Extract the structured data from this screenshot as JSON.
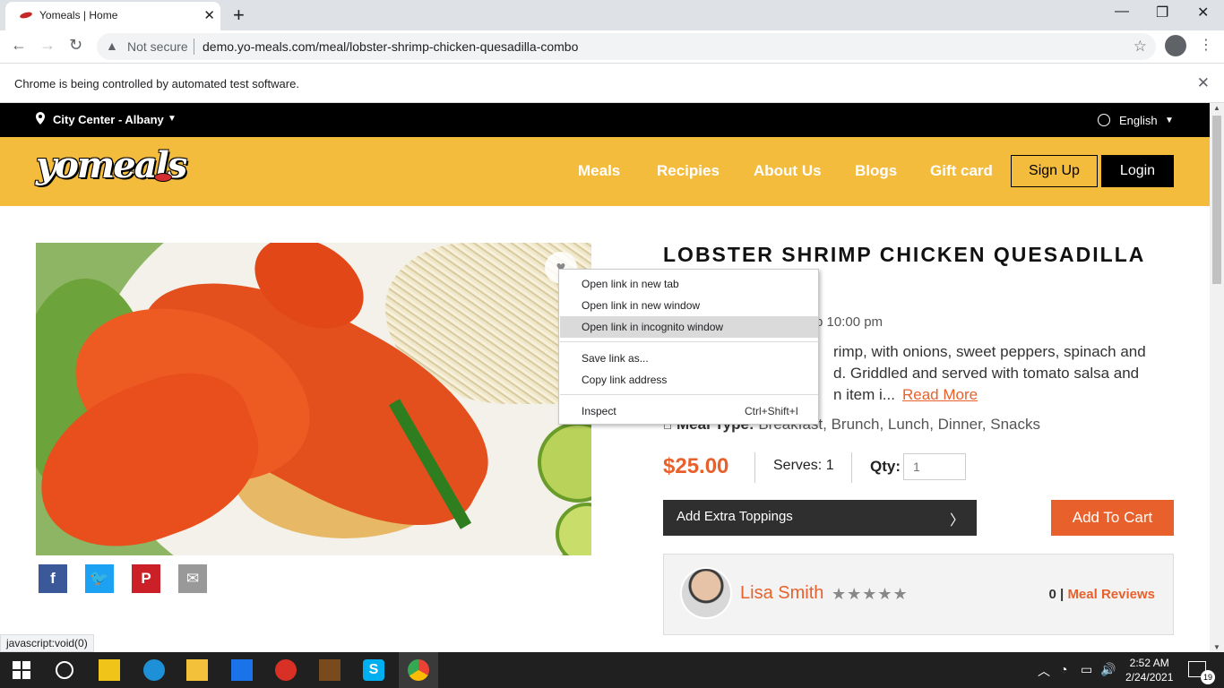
{
  "browser": {
    "tab_title": "Yomeals | Home",
    "security_label": "Not secure",
    "url": "demo.yo-meals.com/meal/lobster-shrimp-chicken-quesadilla-combo",
    "automation_notice": "Chrome is being controlled by automated test software.",
    "status_link": "javascript:void(0)"
  },
  "topbar": {
    "location": "City Center - Albany",
    "language": "English"
  },
  "header": {
    "logo": "yomeals",
    "nav": [
      "Meals",
      "Recipies",
      "About Us",
      "Blogs",
      "Gift card"
    ],
    "signup": "Sign Up",
    "login": "Login"
  },
  "product": {
    "title": "LOBSTER SHRIMP CHICKEN QUESADILLA COMBO",
    "hours_fragment": "p 10:00 pm",
    "desc_line1": "rimp, with onions, sweet peppers, spinach and",
    "desc_line2": "d. Griddled and served with tomato salsa and",
    "desc_line3": "n item i...",
    "read_more": "Read More",
    "meal_type_label": "Meal Type:",
    "meal_type_value": "Breakfast, Brunch, Lunch, Dinner, Snacks",
    "price": "$25.00",
    "serves": "Serves: 1",
    "qty_label": "Qty:",
    "qty_placeholder": "1",
    "extra_toppings": "Add Extra Toppings",
    "add_to_cart": "Add To Cart",
    "rating_stars": "★★★★★",
    "chef": {
      "name": "Lisa Smith",
      "review_count": "0",
      "reviews_label": "Meal Reviews"
    }
  },
  "context_menu": {
    "items": [
      {
        "label": "Open link in new tab",
        "shortcut": ""
      },
      {
        "label": "Open link in new window",
        "shortcut": ""
      },
      {
        "label": "Open link in incognito window",
        "shortcut": ""
      },
      {
        "label": "Save link as...",
        "shortcut": ""
      },
      {
        "label": "Copy link address",
        "shortcut": ""
      },
      {
        "label": "Inspect",
        "shortcut": "Ctrl+Shift+I"
      }
    ],
    "highlighted_index": 2
  },
  "taskbar": {
    "time": "2:52 AM",
    "date": "2/24/2021",
    "notification_count": "19"
  },
  "colors": {
    "accent": "#e8612c",
    "header": "#f4bc3c"
  }
}
